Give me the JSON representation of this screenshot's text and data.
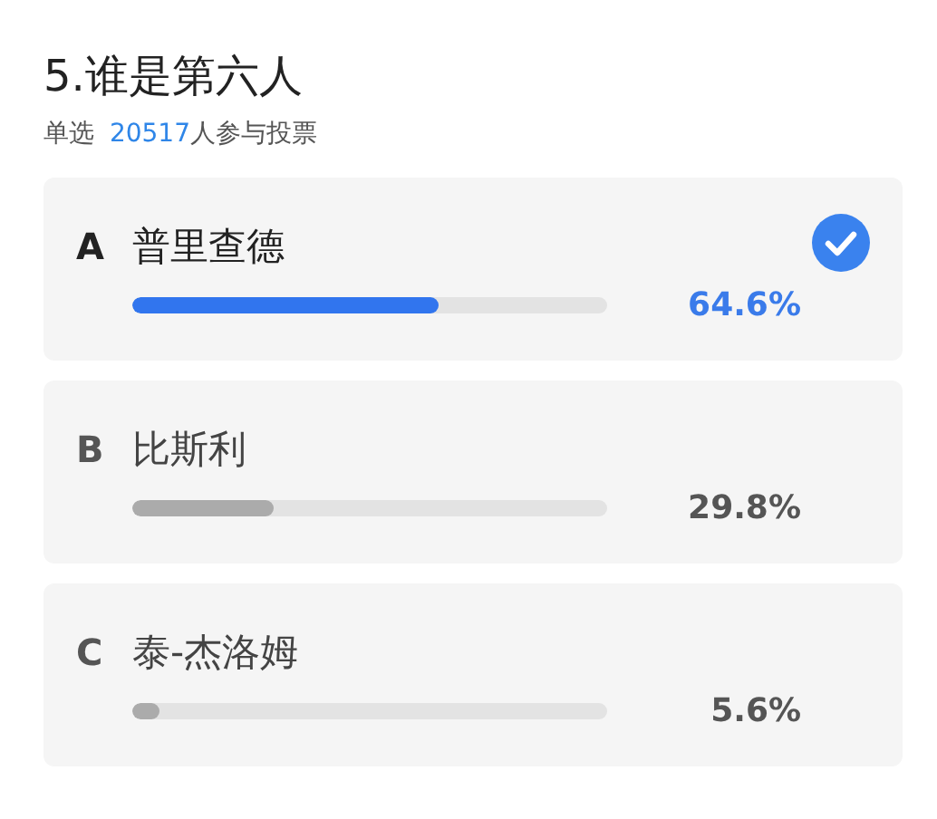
{
  "poll": {
    "title": "5.谁是第六人",
    "mode": "单选",
    "voter_count": "20517",
    "voter_suffix": "人参与投票",
    "options": [
      {
        "letter": "A",
        "name": "普里查德",
        "level": 0.646,
        "percent": "64.6%",
        "selected": true
      },
      {
        "letter": "B",
        "name": "比斯利",
        "level": 0.298,
        "percent": "29.8%",
        "selected": false
      },
      {
        "letter": "C",
        "name": "泰-杰洛姆",
        "level": 0.056,
        "percent": "5.6%",
        "selected": false
      }
    ]
  }
}
